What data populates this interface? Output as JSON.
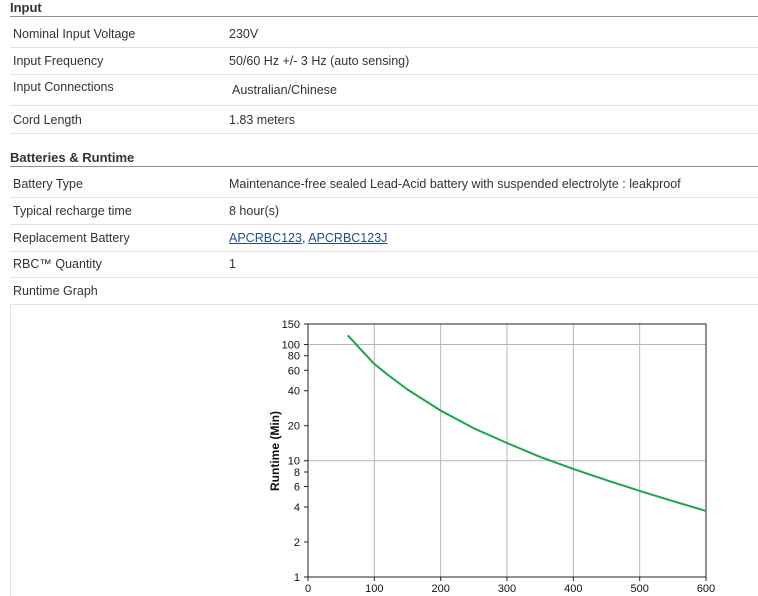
{
  "sections": {
    "input": {
      "title": "Input",
      "rows": [
        {
          "label": "Nominal Input Voltage",
          "value": "230V"
        },
        {
          "label": "Input Frequency",
          "value": "50/60 Hz +/- 3 Hz (auto sensing)"
        },
        {
          "label": "Input Connections",
          "value": "Australian/Chinese"
        },
        {
          "label": "Cord Length",
          "value": "1.83 meters"
        }
      ]
    },
    "batteries": {
      "title": "Batteries & Runtime",
      "rows": [
        {
          "label": "Battery Type",
          "value": "Maintenance-free sealed Lead-Acid battery with suspended electrolyte : leakproof"
        },
        {
          "label": "Typical recharge time",
          "value": "8 hour(s)"
        },
        {
          "label": "Replacement Battery",
          "links": [
            "APCRBC123",
            "APCRBC123J"
          ],
          "separator": ", "
        },
        {
          "label": "RBC™ Quantity",
          "value": "1"
        },
        {
          "label": "Runtime Graph",
          "value": ""
        }
      ]
    }
  },
  "colors": {
    "link": "#1f4e8a",
    "curve": "#1aa64a",
    "rule": "#8f8f8f"
  },
  "chart_data": {
    "type": "line",
    "title": "",
    "xlabel": "",
    "ylabel": "Runtime (Min)",
    "xlim": [
      0,
      600
    ],
    "ylim": [
      1,
      150
    ],
    "yscale": "log",
    "grid": true,
    "x_ticks": [
      "0",
      "100",
      "200",
      "300",
      "400",
      "500",
      "600"
    ],
    "y_ticks": [
      "1",
      "2",
      "4",
      "6",
      "8",
      "10",
      "20",
      "40",
      "60",
      "80",
      "100",
      "150"
    ],
    "series": [
      {
        "x": [
          60,
          80,
          100,
          120,
          150,
          200,
          250,
          300,
          350,
          400,
          450,
          500,
          550,
          600
        ],
        "y": [
          120,
          90,
          68,
          55,
          41,
          27,
          19,
          14.2,
          10.8,
          8.5,
          6.8,
          5.5,
          4.5,
          3.7
        ]
      }
    ]
  }
}
